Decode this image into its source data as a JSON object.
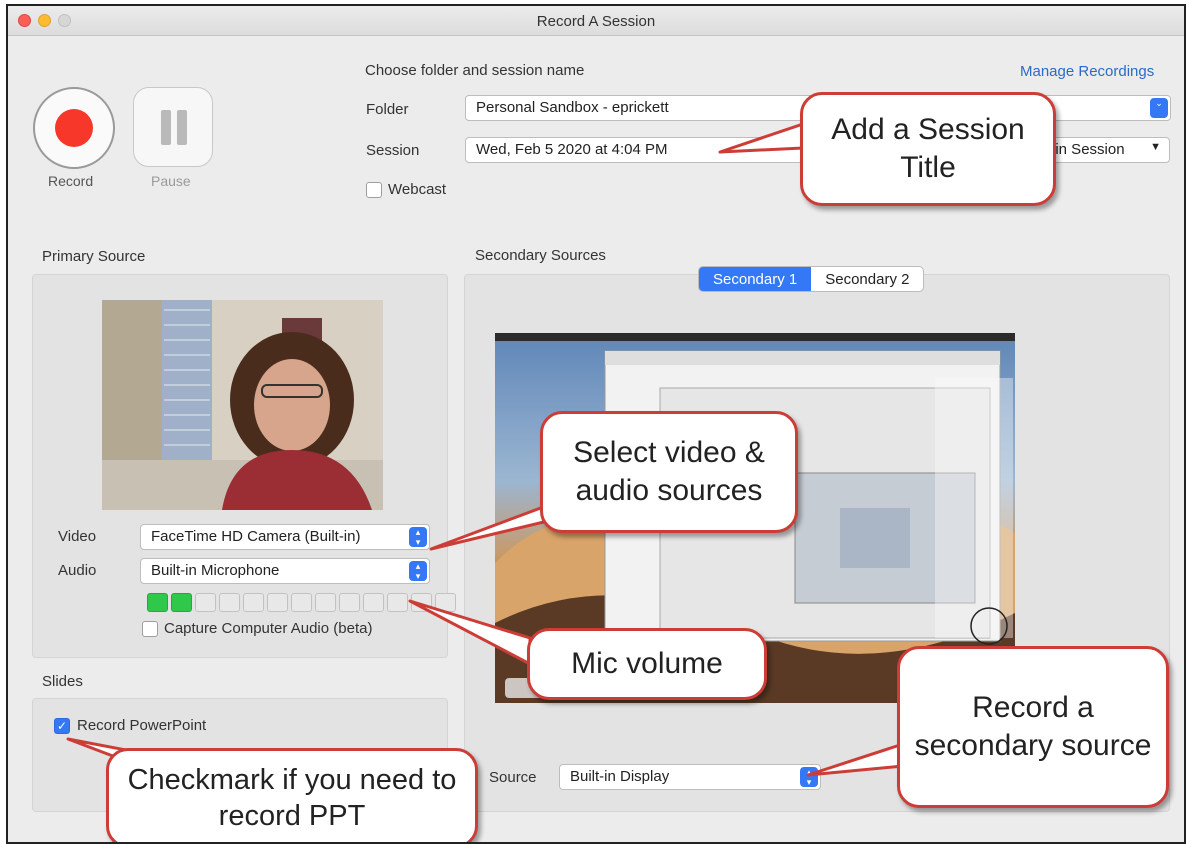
{
  "window": {
    "title": "Record A Session"
  },
  "controls": {
    "record_label": "Record",
    "pause_label": "Pause"
  },
  "session": {
    "heading": "Choose folder and session name",
    "manage_link": "Manage Recordings",
    "folder_label": "Folder",
    "folder_value": "Personal Sandbox - eprickett",
    "session_label": "Session",
    "session_value": "Wed, Feb 5 2020 at 4:04 PM",
    "join_session": "oin Session",
    "webcast_label": "Webcast"
  },
  "primary": {
    "heading": "Primary Source",
    "video_label": "Video",
    "video_value": "FaceTime HD Camera (Built-in)",
    "audio_label": "Audio",
    "audio_value": "Built-in Microphone",
    "capture_audio_label": "Capture Computer Audio (beta)",
    "meter_total": 13,
    "meter_lit": 2
  },
  "slides": {
    "heading": "Slides",
    "record_ppt_label": "Record PowerPoint",
    "record_ppt_checked": true
  },
  "secondary": {
    "heading": "Secondary Sources",
    "tabs": [
      "Secondary 1",
      "Secondary 2"
    ],
    "active_tab": 0,
    "source_label": "Source",
    "source_value": "Built-in Display"
  },
  "callouts": {
    "session_title": "Add a Session Title",
    "video_audio": "Select video & audio sources",
    "mic": "Mic volume",
    "secondary": "Record a secondary source",
    "ppt": "Checkmark if you need to record PPT"
  },
  "colors": {
    "accent": "#3478f6",
    "record": "#f6372a",
    "callout_border": "#cc3d37",
    "meter_on": "#2fc84a"
  }
}
